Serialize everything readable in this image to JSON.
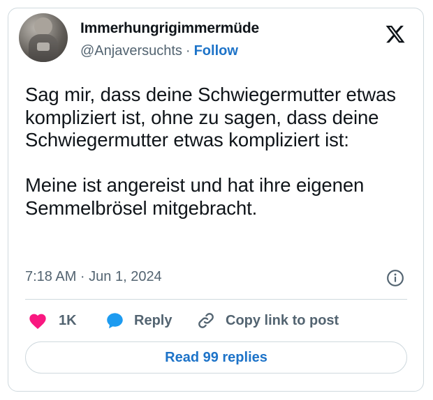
{
  "author": {
    "display_name": "Immerhungrigimmermüde",
    "handle": "@Anjaversuchts",
    "separator": "·",
    "follow_label": "Follow"
  },
  "tweet": {
    "paragraphs": [
      "Sag mir, dass deine Schwiegermutter etwas kompliziert ist, ohne zu sagen, dass deine Schwiegermutter etwas kompliziert ist:",
      "Meine ist angereist und hat ihre eigenen Semmelbrösel mitgebracht."
    ],
    "timestamp": "7:18 AM · Jun 1, 2024"
  },
  "actions": {
    "like_count": "1K",
    "reply_label": "Reply",
    "copy_label": "Copy link to post"
  },
  "read_replies_label": "Read 99 replies",
  "icons": {
    "platform": "x-logo-icon",
    "info": "info-icon",
    "like": "heart-icon",
    "reply": "speech-bubble-icon",
    "copy": "link-icon"
  },
  "colors": {
    "link_blue": "#1d73c8",
    "heart": "#f91880",
    "reply_bubble": "#1d9bf0",
    "muted_text": "#536471",
    "border": "#cfd9de"
  }
}
